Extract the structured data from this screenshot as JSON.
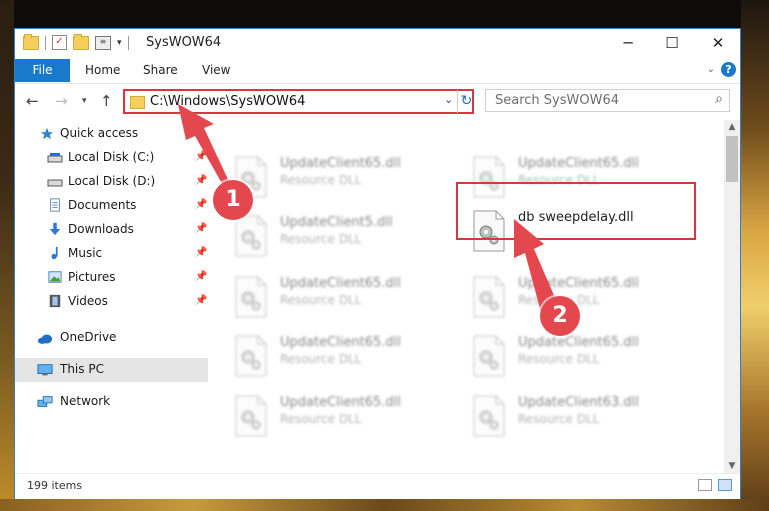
{
  "window": {
    "title": "SysWOW64",
    "controls": {
      "minimize": "─",
      "maximize": "☐",
      "close": "✕"
    }
  },
  "ribbon": {
    "file_tab": "File",
    "tabs": [
      "Home",
      "Share",
      "View"
    ]
  },
  "address_bar": {
    "path": "C:\\Windows\\SysWOW64",
    "search_placeholder": "Search SysWOW64"
  },
  "sidebar": {
    "quick_access": "Quick access",
    "pinned": [
      {
        "label": "Local Disk (C:)",
        "icon": "drive-icon"
      },
      {
        "label": "Local Disk (D:)",
        "icon": "drive-icon"
      },
      {
        "label": "Documents",
        "icon": "documents-icon"
      },
      {
        "label": "Downloads",
        "icon": "downloads-icon"
      },
      {
        "label": "Music",
        "icon": "music-icon"
      },
      {
        "label": "Pictures",
        "icon": "pictures-icon"
      },
      {
        "label": "Videos",
        "icon": "videos-icon"
      }
    ],
    "onedrive": "OneDrive",
    "this_pc": "This PC",
    "network": "Network"
  },
  "files": [
    {
      "name": "UpdateClient65.dll",
      "type": "Resource DLL"
    },
    {
      "name": "UpdateClient65.dll",
      "type": "Resource DLL"
    },
    {
      "name": "UpdateClient5.dll",
      "type": "Resource DLL"
    },
    {
      "name": "db sweepdelay.dll",
      "type": ""
    },
    {
      "name": "UpdateClient65.dll",
      "type": "Resource DLL"
    },
    {
      "name": "UpdateClient65.dll",
      "type": "Resource DLL"
    },
    {
      "name": "UpdateClient65.dll",
      "type": "Resource DLL"
    },
    {
      "name": "UpdateClient65.dll",
      "type": "Resource DLL"
    },
    {
      "name": "UpdateClient65.dll",
      "type": "Resource DLL"
    },
    {
      "name": "UpdateClient63.dll",
      "type": "Resource DLL"
    }
  ],
  "status": {
    "item_count": "199 items"
  },
  "annotations": {
    "step1": "1",
    "step2": "2",
    "color": "#e2484d"
  }
}
